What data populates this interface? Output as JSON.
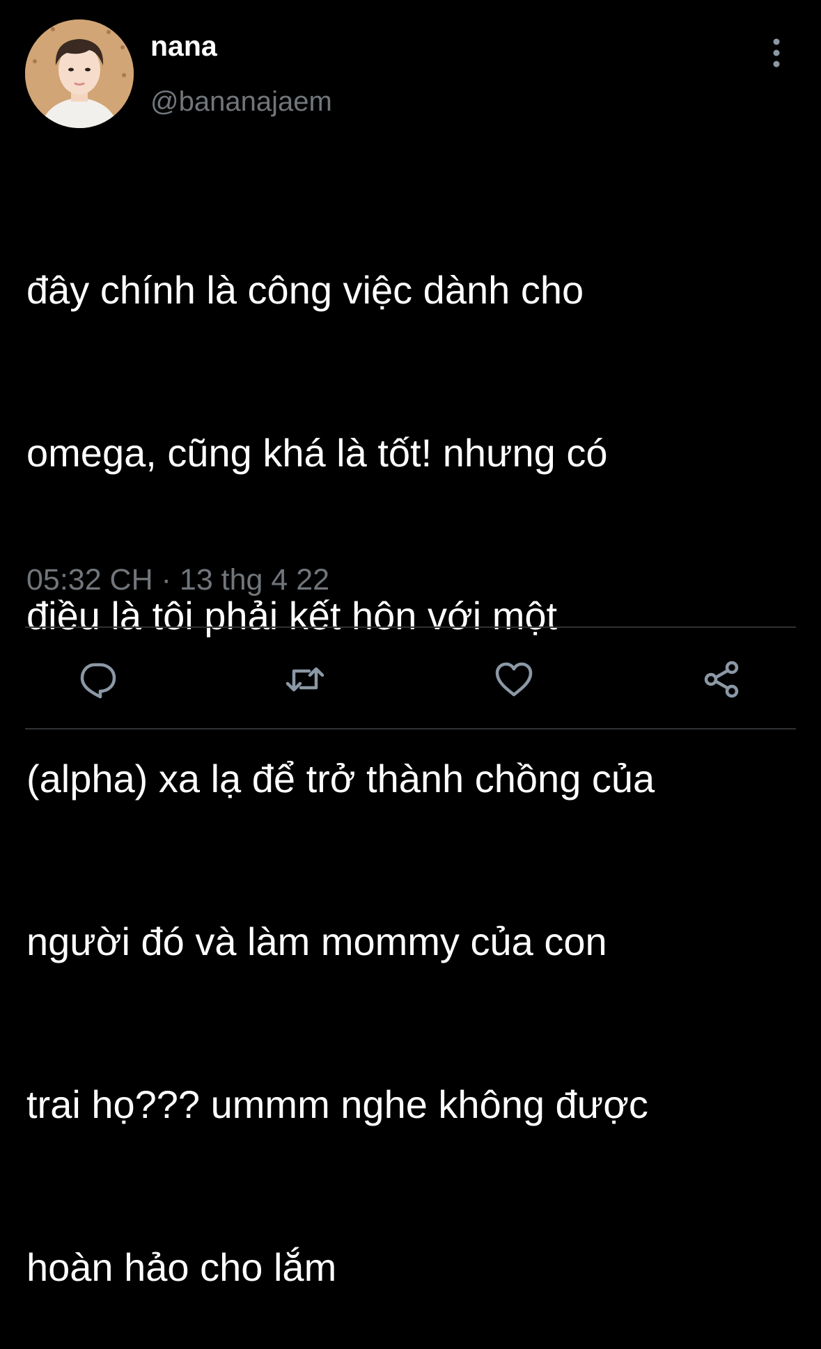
{
  "colors": {
    "background": "#000000",
    "text_primary": "#ffffff",
    "text_secondary": "#71767b",
    "divider": "#2f3336",
    "icon": "#8b98a5"
  },
  "user": {
    "display_name": "nana",
    "handle": "@bananajaem",
    "avatar_icon": "avatar-photo"
  },
  "tweet": {
    "lines": [
      "đây chính là công việc dành cho",
      "omega, cũng khá là tốt! nhưng có",
      "điều là tôi phải kết hôn với một",
      "(alpha) xa lạ để trở thành chồng của",
      "người đó và làm mommy của con",
      "trai họ??? ummm nghe không được",
      "hoàn hảo cho lắm"
    ],
    "time": "05:32 CH",
    "separator": "·",
    "date": "13 thg 4 22"
  },
  "actions": {
    "reply_icon": "comment-bubble-icon",
    "retweet_icon": "retweet-arrows-icon",
    "like_icon": "heart-icon",
    "share_icon": "share-nodes-icon",
    "more_icon": "vertical-ellipsis-icon"
  }
}
